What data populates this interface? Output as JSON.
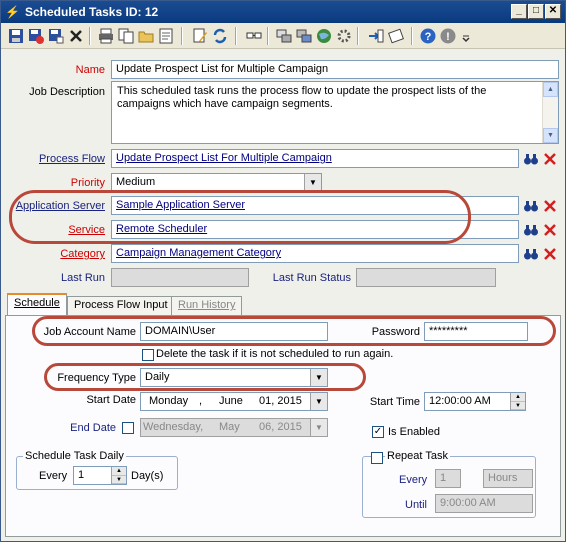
{
  "window": {
    "title": "Scheduled Tasks ID: 12",
    "min": "_",
    "max": "□",
    "close": "✕"
  },
  "toolbar": {
    "icons": [
      "save-icon",
      "save-close-icon",
      "save-new-icon",
      "delete-icon",
      "print-icon",
      "copy-icon",
      "open-folder-icon",
      "page-icon",
      "edit-icon",
      "refresh-icon",
      "link-icon",
      "grid-icon",
      "grid2-icon",
      "globe-icon",
      "settings-icon",
      "import-icon",
      "export-icon",
      "help-icon",
      "info-icon",
      "more-icon"
    ]
  },
  "form": {
    "name_label": "Name",
    "name_value": "Update Prospect List for Multiple Campaign",
    "desc_label": "Job Description",
    "desc_value": "This scheduled task runs the process flow to update the prospect lists of the campaigns which have campaign segments.",
    "process_flow_label": "Process Flow",
    "process_flow_value": "Update Prospect List For Multiple Campaign",
    "priority_label": "Priority",
    "priority_value": "Medium",
    "app_server_label": "Application Server",
    "app_server_value": "Sample Application Server",
    "service_label": "Service",
    "service_value": "Remote Scheduler",
    "category_label": "Category",
    "category_value": "Campaign Management Category",
    "last_run_label": "Last Run",
    "last_run_status_label": "Last Run Status"
  },
  "tabs": [
    {
      "label": "Schedule",
      "active": true
    },
    {
      "label": "Process Flow Input",
      "active": false
    },
    {
      "label": "Run History",
      "active": false
    }
  ],
  "schedule": {
    "job_account_label": "Job Account Name",
    "job_account_value": "DOMAIN\\User",
    "password_label": "Password",
    "password_value": "*********",
    "delete_label": "Delete the task if it is not scheduled to run again.",
    "frequency_label": "Frequency Type",
    "frequency_value": "Daily",
    "start_date_label": "Start Date",
    "start_date_day": "Monday",
    "start_date_sep": ",",
    "start_date_month": "June",
    "start_date_rest": "01, 2015",
    "start_time_label": "Start Time",
    "start_time_value": "12:00:00 AM",
    "end_date_label": "End Date",
    "end_date_day": "Wednesday,",
    "end_date_month": "May",
    "end_date_rest": "06, 2015",
    "enabled_label": "Is Enabled",
    "enabled_check": "✓",
    "daily_group_title": "Schedule Task Daily",
    "every_label": "Every",
    "every_value": "1",
    "days_label": "Day(s)",
    "repeat_label": "Repeat Task",
    "repeat_every_label": "Every",
    "repeat_every_value": "1",
    "repeat_unit": "Hours",
    "until_label": "Until",
    "until_value": "9:00:00 AM"
  },
  "colors": {
    "highlight": "#b8493a",
    "required": "#cc0000",
    "link": "#1a237e"
  }
}
